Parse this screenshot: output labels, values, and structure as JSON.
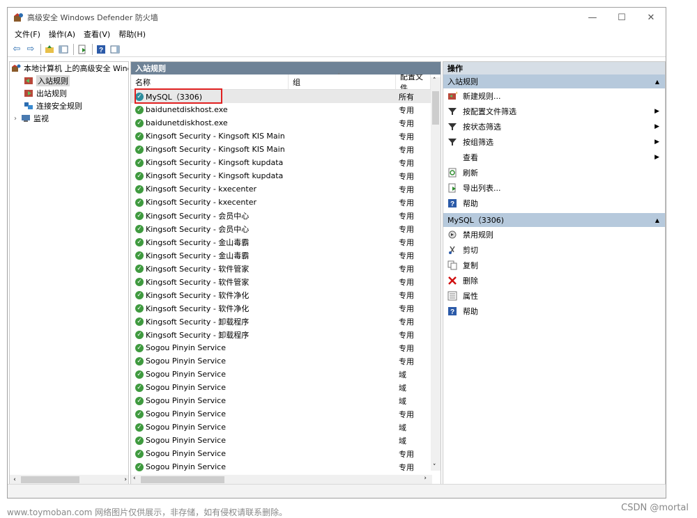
{
  "window": {
    "title": "高级安全 Windows Defender 防火墙",
    "controls": [
      "—",
      "☐",
      "✕"
    ]
  },
  "menu": [
    "文件(F)",
    "操作(A)",
    "查看(V)",
    "帮助(H)"
  ],
  "tree": {
    "root": "本地计算机 上的高级安全 Wind",
    "items": [
      {
        "label": "入站规则",
        "selected": true
      },
      {
        "label": "出站规则",
        "selected": false
      },
      {
        "label": "连接安全规则",
        "selected": false
      },
      {
        "label": "监视",
        "selected": false
      }
    ]
  },
  "middle": {
    "header": "入站规则",
    "columns": [
      "名称",
      "组",
      "配置文件"
    ],
    "rows": [
      {
        "name": "MySQL（3306)",
        "profile": "所有"
      },
      {
        "name": "baidunetdiskhost.exe",
        "profile": "专用"
      },
      {
        "name": "baidunetdiskhost.exe",
        "profile": "专用"
      },
      {
        "name": "Kingsoft Security - Kingsoft KIS Main",
        "profile": "专用"
      },
      {
        "name": "Kingsoft Security - Kingsoft KIS Main",
        "profile": "专用"
      },
      {
        "name": "Kingsoft Security - Kingsoft kupdata",
        "profile": "专用"
      },
      {
        "name": "Kingsoft Security - Kingsoft kupdata",
        "profile": "专用"
      },
      {
        "name": "Kingsoft Security - kxecenter",
        "profile": "专用"
      },
      {
        "name": "Kingsoft Security - kxecenter",
        "profile": "专用"
      },
      {
        "name": "Kingsoft Security - 会员中心",
        "profile": "专用"
      },
      {
        "name": "Kingsoft Security - 会员中心",
        "profile": "专用"
      },
      {
        "name": "Kingsoft Security - 金山毒霸",
        "profile": "专用"
      },
      {
        "name": "Kingsoft Security - 金山毒霸",
        "profile": "专用"
      },
      {
        "name": "Kingsoft Security - 软件管家",
        "profile": "专用"
      },
      {
        "name": "Kingsoft Security - 软件管家",
        "profile": "专用"
      },
      {
        "name": "Kingsoft Security - 软件净化",
        "profile": "专用"
      },
      {
        "name": "Kingsoft Security - 软件净化",
        "profile": "专用"
      },
      {
        "name": "Kingsoft Security - 卸载程序",
        "profile": "专用"
      },
      {
        "name": "Kingsoft Security - 卸载程序",
        "profile": "专用"
      },
      {
        "name": "Sogou Pinyin Service",
        "profile": "专用"
      },
      {
        "name": "Sogou Pinyin Service",
        "profile": "专用"
      },
      {
        "name": "Sogou Pinyin Service",
        "profile": "域"
      },
      {
        "name": "Sogou Pinyin Service",
        "profile": "域"
      },
      {
        "name": "Sogou Pinyin Service",
        "profile": "域"
      },
      {
        "name": "Sogou Pinyin Service",
        "profile": "专用"
      },
      {
        "name": "Sogou Pinyin Service",
        "profile": "域"
      },
      {
        "name": "Sogou Pinyin Service",
        "profile": "域"
      },
      {
        "name": "Sogou Pinyin Service",
        "profile": "专用"
      },
      {
        "name": "Sogou Pinyin Service",
        "profile": "专用"
      }
    ]
  },
  "actions": {
    "title": "操作",
    "section1": {
      "label": "入站规则",
      "items": [
        {
          "label": "新建规则...",
          "icon": "new-rule-icon",
          "arrow": false
        },
        {
          "label": "按配置文件筛选",
          "icon": "filter-icon",
          "arrow": true
        },
        {
          "label": "按状态筛选",
          "icon": "filter-icon",
          "arrow": true
        },
        {
          "label": "按组筛选",
          "icon": "filter-icon",
          "arrow": true
        },
        {
          "label": "查看",
          "icon": "",
          "arrow": true
        },
        {
          "label": "刷新",
          "icon": "refresh-icon",
          "arrow": false
        },
        {
          "label": "导出列表...",
          "icon": "export-icon",
          "arrow": false
        },
        {
          "label": "帮助",
          "icon": "help-icon",
          "arrow": false
        }
      ]
    },
    "section2": {
      "label": "MySQL（3306)",
      "items": [
        {
          "label": "禁用规则",
          "icon": "disable-icon"
        },
        {
          "label": "剪切",
          "icon": "cut-icon"
        },
        {
          "label": "复制",
          "icon": "copy-icon"
        },
        {
          "label": "删除",
          "icon": "delete-icon"
        },
        {
          "label": "属性",
          "icon": "properties-icon"
        },
        {
          "label": "帮助",
          "icon": "help-icon"
        }
      ]
    }
  },
  "watermark": {
    "left": "www.toymoban.com 网络图片仅供展示，非存储，如有侵权请联系删除。",
    "right": "CSDN @mortal"
  },
  "colors": {
    "pane_header": "#6e8296",
    "action_section": "#b6c9dc",
    "check_green": "#3f9a3f",
    "highlight": "#e02020"
  }
}
